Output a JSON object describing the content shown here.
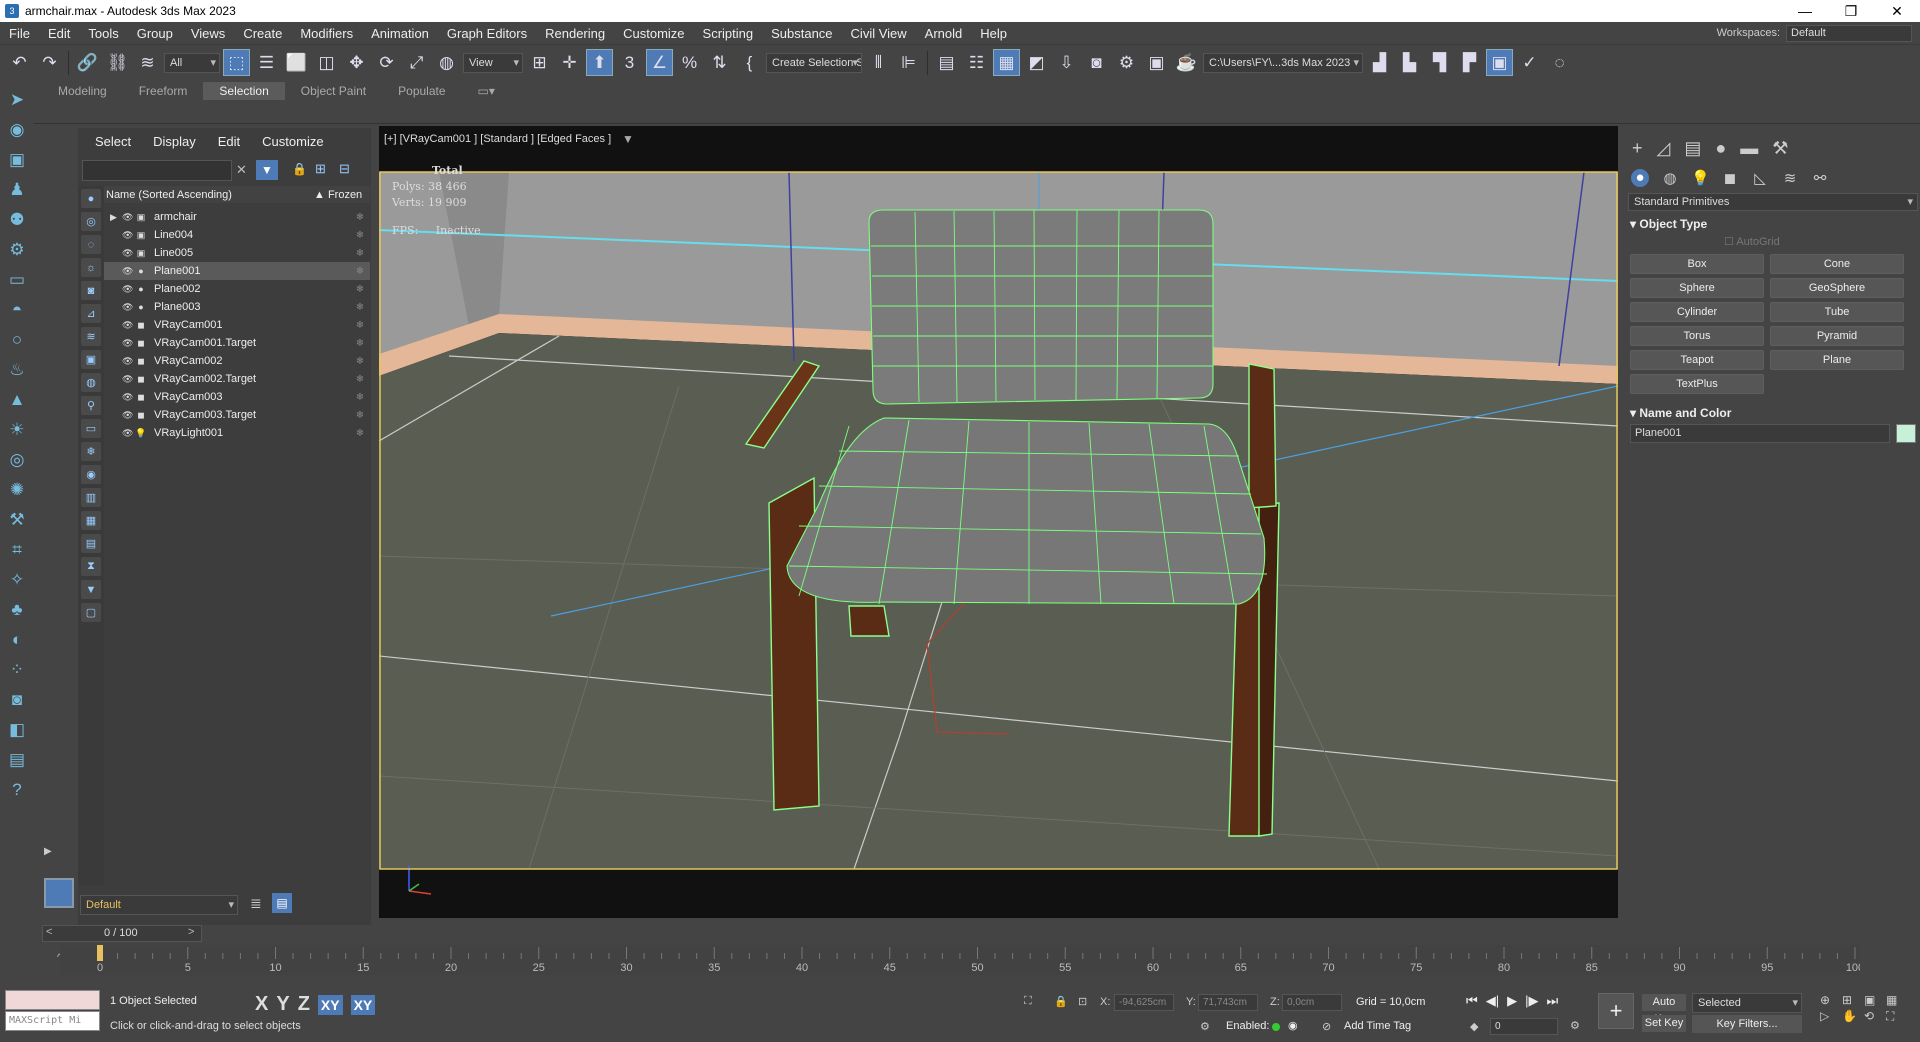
{
  "window": {
    "title": "armchair.max - Autodesk 3ds Max 2023",
    "app_icon": "3ds-max-icon"
  },
  "menu": [
    "File",
    "Edit",
    "Tools",
    "Group",
    "Views",
    "Create",
    "Modifiers",
    "Animation",
    "Graph Editors",
    "Rendering",
    "Customize",
    "Scripting",
    "Substance",
    "Civil View",
    "Arnold",
    "Help"
  ],
  "workspace": {
    "label": "Workspaces:",
    "value": "Default"
  },
  "toolbar": {
    "filter_value": "All",
    "refcoord_value": "View",
    "selection_set": "Create Selection Se",
    "project_path": "C:\\Users\\FY\\...3ds Max 2023"
  },
  "ribbon_tabs": [
    "Modeling",
    "Freeform",
    "Selection",
    "Object Paint",
    "Populate"
  ],
  "ribbon_active": "Selection",
  "scene_explorer": {
    "menu": [
      "Select",
      "Display",
      "Edit",
      "Customize"
    ],
    "col_name": "Name (Sorted Ascending)",
    "col_frozen": "▲ Frozen",
    "items": [
      {
        "name": "armchair",
        "icon": "group-icon",
        "expanded": false,
        "selected": false
      },
      {
        "name": "Line004",
        "icon": "group-icon",
        "selected": false
      },
      {
        "name": "Line005",
        "icon": "group-icon",
        "selected": false
      },
      {
        "name": "Plane001",
        "icon": "sphere-icon",
        "selected": true
      },
      {
        "name": "Plane002",
        "icon": "sphere-icon",
        "selected": false
      },
      {
        "name": "Plane003",
        "icon": "sphere-icon",
        "selected": false
      },
      {
        "name": "VRayCam001",
        "icon": "camera-icon",
        "selected": false
      },
      {
        "name": "VRayCam001.Target",
        "icon": "camera-icon",
        "selected": false
      },
      {
        "name": "VRayCam002",
        "icon": "camera-icon",
        "selected": false
      },
      {
        "name": "VRayCam002.Target",
        "icon": "camera-icon",
        "selected": false
      },
      {
        "name": "VRayCam003",
        "icon": "camera-icon",
        "selected": false
      },
      {
        "name": "VRayCam003.Target",
        "icon": "camera-icon",
        "selected": false
      },
      {
        "name": "VRayLight001",
        "icon": "light-icon",
        "selected": false
      }
    ],
    "layer": "Default"
  },
  "viewport": {
    "label": "[+] [VRayCam001 ] [Standard ] [Edged Faces ]",
    "stats": {
      "header": "Total",
      "polys_label": "Polys:",
      "polys": "38 466",
      "verts_label": "Verts:",
      "verts": "19 909",
      "fps_label": "FPS:",
      "fps": "Inactive"
    }
  },
  "command_panel": {
    "dropdown": "Standard Primitives",
    "object_type_title": "Object Type",
    "autogrid": "AutoGrid",
    "buttons": [
      "Box",
      "Cone",
      "Sphere",
      "GeoSphere",
      "Cylinder",
      "Tube",
      "Torus",
      "Pyramid",
      "Teapot",
      "Plane",
      "TextPlus"
    ],
    "name_color_title": "Name and Color",
    "object_name": "Plane001",
    "object_color": "#c8f0d8"
  },
  "timeline": {
    "position": "0 / 100",
    "ticks": [
      "0",
      "5",
      "10",
      "15",
      "20",
      "25",
      "30",
      "35",
      "40",
      "45",
      "50",
      "55",
      "60",
      "65",
      "70",
      "75",
      "80",
      "85",
      "90",
      "95",
      "100"
    ]
  },
  "status": {
    "maxscript": "MAXScript Mi",
    "selected": "1 Object Selected",
    "prompt": "Click or click-and-drag to select objects",
    "axes": [
      "X",
      "Y",
      "Z",
      "XY",
      "XY"
    ],
    "x_label": "X:",
    "x": "-94,625cm",
    "y_label": "Y:",
    "y": "71,743cm",
    "z_label": "Z:",
    "z": "0,0cm",
    "grid": "Grid = 10,0cm",
    "enabled": "Enabled:",
    "add_time_tag": "Add Time Tag",
    "auto_key": "Auto Key",
    "set_key": "Set Key",
    "key_mode": "Selected",
    "key_filters": "Key Filters...",
    "frame": "0"
  },
  "colors": {
    "accent": "#4e7ab5",
    "wire": "#7dff7d",
    "viewport_bg": "#5a5d52"
  }
}
